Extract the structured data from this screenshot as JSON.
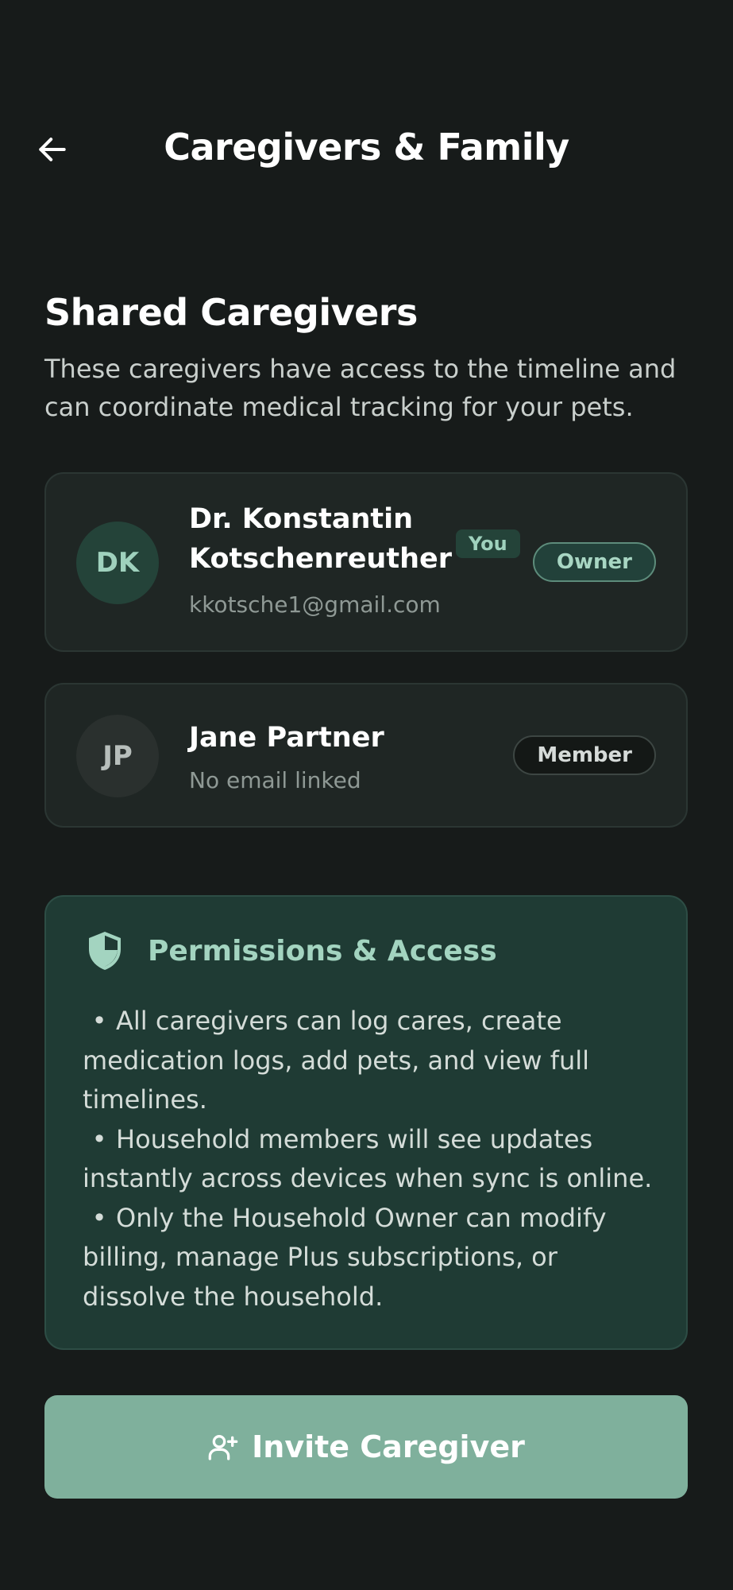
{
  "header": {
    "title": "Caregivers & Family",
    "back_icon": "arrow-left-icon"
  },
  "section": {
    "title": "Shared Caregivers",
    "subtitle": "These caregivers have access to the timeline and can coordinate medical tracking for your pets."
  },
  "caregivers": [
    {
      "initials": "DK",
      "name": "Dr. Konstantin Kotschenreuther",
      "you_badge": "You",
      "email": "kkotsche1@gmail.com",
      "role": "Owner"
    },
    {
      "initials": "JP",
      "name": "Jane Partner",
      "email": "No email linked",
      "role": "Member"
    }
  ],
  "permissions": {
    "icon": "shield-icon",
    "title": "Permissions & Access",
    "items": [
      "All caregivers can log cares, create medication logs, add pets, and view full timelines.",
      "Household members will see updates instantly across devices when sync is online.",
      "Only the Household Owner can modify billing, manage Plus subscriptions, or dissolve the household."
    ]
  },
  "invite_button": {
    "label": "Invite Caregiver",
    "icon": "user-plus-icon"
  },
  "colors": {
    "background": "#171b1a",
    "card": "#1f2624",
    "accent": "#7fb09c",
    "permissions_bg": "#1f3b34"
  }
}
